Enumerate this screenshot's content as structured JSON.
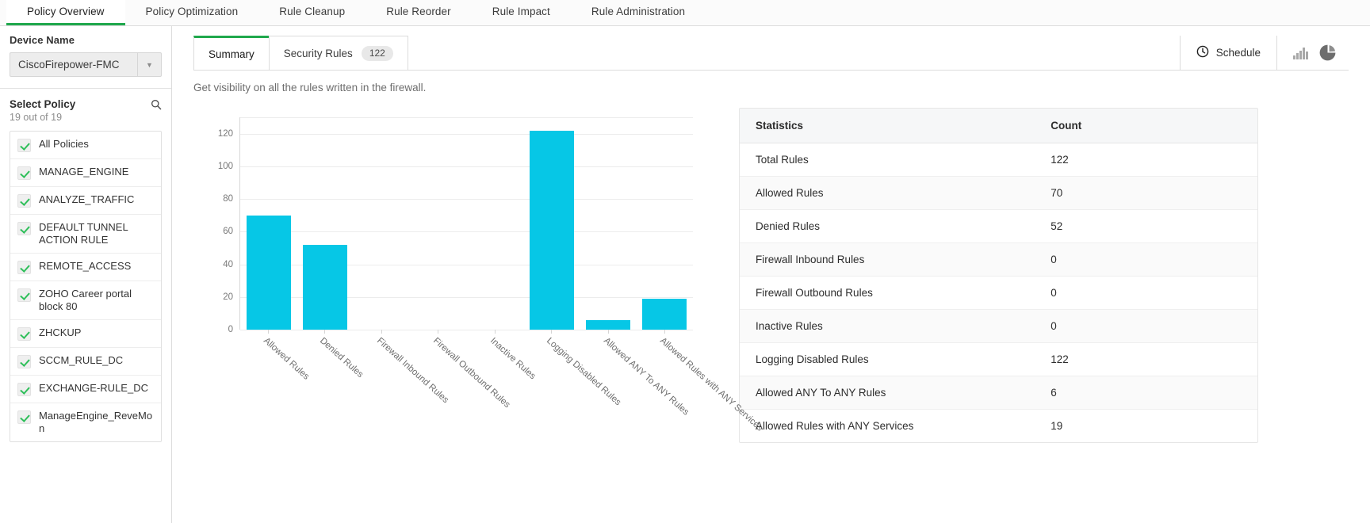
{
  "topnav": {
    "items": [
      {
        "label": "Policy Overview",
        "active": true
      },
      {
        "label": "Policy Optimization",
        "active": false
      },
      {
        "label": "Rule Cleanup",
        "active": false
      },
      {
        "label": "Rule Reorder",
        "active": false
      },
      {
        "label": "Rule Impact",
        "active": false
      },
      {
        "label": "Rule Administration",
        "active": false
      }
    ]
  },
  "sidebar": {
    "device_label": "Device Name",
    "device_value": "CiscoFirepower-FMC",
    "device_dropdown_icon": "chevron-down-icon",
    "policy_title": "Select Policy",
    "policy_search_icon": "search-icon",
    "policy_count": "19 out of 19",
    "policies": [
      {
        "label": "All Policies",
        "checked": true
      },
      {
        "label": "MANAGE_ENGINE",
        "checked": true
      },
      {
        "label": "ANALYZE_TRAFFIC",
        "checked": true
      },
      {
        "label": "DEFAULT TUNNEL ACTION RULE",
        "checked": true
      },
      {
        "label": "REMOTE_ACCESS",
        "checked": true
      },
      {
        "label": "ZOHO Career portal block 80",
        "checked": true
      },
      {
        "label": "ZHCKUP",
        "checked": true
      },
      {
        "label": "SCCM_RULE_DC",
        "checked": true
      },
      {
        "label": "EXCHANGE-RULE_DC",
        "checked": true
      },
      {
        "label": "ManageEngine_ReveMon",
        "checked": true
      }
    ]
  },
  "main": {
    "tabs": [
      {
        "label": "Summary",
        "badge": "",
        "active": true
      },
      {
        "label": "Security Rules",
        "badge": "122",
        "active": false
      }
    ],
    "schedule_label": "Schedule",
    "schedule_icon": "clock-icon",
    "bar_chart_icon": "bar-chart-icon",
    "pie_chart_icon": "pie-chart-icon",
    "subtitle": "Get visibility on all the rules written in the firewall."
  },
  "stats_table": {
    "headers": [
      "Statistics",
      "Count"
    ],
    "rows": [
      {
        "name": "Total Rules",
        "count": "122",
        "link": true
      },
      {
        "name": "Allowed Rules",
        "count": "70",
        "link": true
      },
      {
        "name": "Denied Rules",
        "count": "52",
        "link": true
      },
      {
        "name": "Firewall Inbound Rules",
        "count": "0",
        "link": false
      },
      {
        "name": "Firewall Outbound Rules",
        "count": "0",
        "link": false
      },
      {
        "name": "Inactive Rules",
        "count": "0",
        "link": false
      },
      {
        "name": "Logging Disabled Rules",
        "count": "122",
        "link": true
      },
      {
        "name": "Allowed ANY To ANY Rules",
        "count": "6",
        "link": true
      },
      {
        "name": "Allowed Rules with ANY Services",
        "count": "19",
        "link": true
      }
    ]
  },
  "chart_data": {
    "type": "bar",
    "title": "",
    "xlabel": "",
    "ylabel": "",
    "ylim": [
      0,
      130
    ],
    "yticks": [
      0,
      20,
      40,
      60,
      80,
      100,
      120
    ],
    "grid": true,
    "legend": false,
    "bar_color": "#06c7e6",
    "categories": [
      "Allowed Rules",
      "Denied Rules",
      "Firewall Inbound Rules",
      "Firewall Outbound Rules",
      "Inactive Rules",
      "Logging Disabled Rules",
      "Allowed ANY To ANY Rules",
      "Allowed Rules with ANY Services"
    ],
    "values": [
      70,
      52,
      0,
      0,
      0,
      122,
      6,
      19
    ]
  },
  "colors": {
    "accent_green": "#1fa84c",
    "bar_cyan": "#06c7e6",
    "link_blue": "#1c26e6",
    "check_green": "#2fbf5a"
  }
}
